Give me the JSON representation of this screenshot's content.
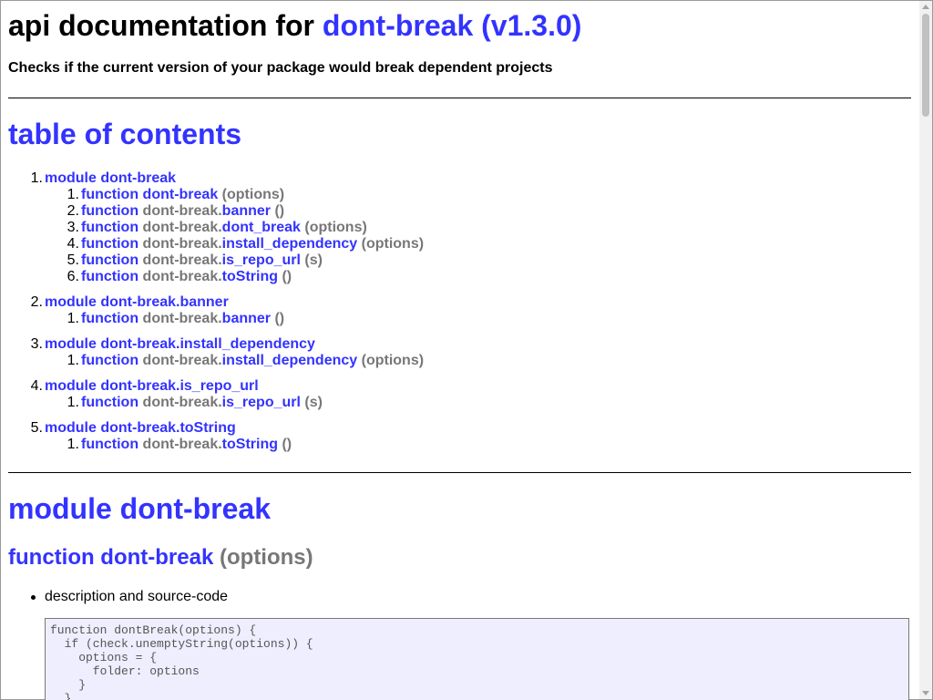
{
  "header": {
    "title_prefix": "api documentation for",
    "package_name": "dont-break",
    "package_version": "(v1.3.0)",
    "package_link": "dont-break (v1.3.0)",
    "subtitle": "Checks if the current version of your package would break dependent projects"
  },
  "toc": {
    "heading": "table of contents",
    "modules": [
      {
        "number": "1.",
        "label": "module dont-break",
        "functions": [
          {
            "number": "1.",
            "keyword": "function",
            "prefix": "",
            "name": "dont-break",
            "args": "(options)"
          },
          {
            "number": "2.",
            "keyword": "function",
            "prefix": "dont-break.",
            "name": "banner",
            "args": "()"
          },
          {
            "number": "3.",
            "keyword": "function",
            "prefix": "dont-break.",
            "name": "dont_break",
            "args": "(options)"
          },
          {
            "number": "4.",
            "keyword": "function",
            "prefix": "dont-break.",
            "name": "install_dependency",
            "args": "(options)"
          },
          {
            "number": "5.",
            "keyword": "function",
            "prefix": "dont-break.",
            "name": "is_repo_url",
            "args": "(s)"
          },
          {
            "number": "6.",
            "keyword": "function",
            "prefix": "dont-break.",
            "name": "toString",
            "args": "()"
          }
        ]
      },
      {
        "number": "2.",
        "label": "module dont-break.banner",
        "functions": [
          {
            "number": "1.",
            "keyword": "function",
            "prefix": "dont-break.",
            "name": "banner",
            "args": "()"
          }
        ]
      },
      {
        "number": "3.",
        "label": "module dont-break.install_dependency",
        "functions": [
          {
            "number": "1.",
            "keyword": "function",
            "prefix": "dont-break.",
            "name": "install_dependency",
            "args": "(options)"
          }
        ]
      },
      {
        "number": "4.",
        "label": "module dont-break.is_repo_url",
        "functions": [
          {
            "number": "1.",
            "keyword": "function",
            "prefix": "dont-break.",
            "name": "is_repo_url",
            "args": "(s)"
          }
        ]
      },
      {
        "number": "5.",
        "label": "module dont-break.toString",
        "functions": [
          {
            "number": "1.",
            "keyword": "function",
            "prefix": "dont-break.",
            "name": "toString",
            "args": "()"
          }
        ]
      }
    ]
  },
  "module_section": {
    "heading": "module dont-break",
    "function_heading": {
      "keyword_name": "function dont-break",
      "args": "(options)"
    },
    "bullet": "description and source-code",
    "code": "function dontBreak(options) {\n  if (check.unemptyString(options)) {\n    options = {\n      folder: options\n    }\n  }"
  }
}
